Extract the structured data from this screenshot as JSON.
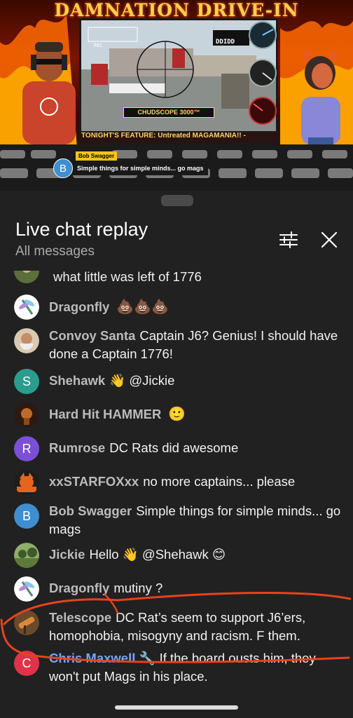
{
  "video": {
    "title": "DAMNATION DRIVE-IN",
    "scope_label": "CHUDSCOPE 3000™",
    "feature": "TONIGHT'S FEATURE: Untreated MAGAMANIA!! -",
    "osd_rec": "REC",
    "osd_cam": "DDIDD",
    "ticker": {
      "author": "Bob Swagger",
      "avatar_letter": "B",
      "text": "Simple things for simple minds... go mags"
    }
  },
  "chat": {
    "title": "Live chat replay",
    "subtitle": "All messages",
    "messages": [
      {
        "author": "",
        "text": "what little was left of 1776",
        "avatar_type": "image",
        "author_color": "default"
      },
      {
        "author": "Dragonfly",
        "text": "💩💩💩",
        "avatar_type": "image",
        "author_color": "default"
      },
      {
        "author": "Convoy Santa",
        "text": "Captain J6? Genius! I should have done a Captain 1776!",
        "avatar_type": "image",
        "author_color": "default"
      },
      {
        "author": "Shehawk",
        "text": "👋 @Jickie",
        "avatar_type": "letter",
        "avatar_letter": "S",
        "avatar_color": "#2a9d8f",
        "author_color": "default"
      },
      {
        "author": "Hard Hit HAMMER",
        "text": "🙂",
        "avatar_type": "image",
        "author_color": "default"
      },
      {
        "author": "Rumrose",
        "text": "DC Rats did awesome",
        "avatar_type": "letter",
        "avatar_letter": "R",
        "avatar_color": "#7b4fd6",
        "author_color": "default"
      },
      {
        "author": "xxSTARFOXxx",
        "text": "no more captains... please",
        "avatar_type": "image",
        "author_color": "default"
      },
      {
        "author": "Bob Swagger",
        "text": "Simple things for simple minds... go mags",
        "avatar_type": "letter",
        "avatar_letter": "B",
        "avatar_color": "#3e8ed0",
        "author_color": "default"
      },
      {
        "author": "Jickie",
        "text": "Hello 👋 @Shehawk 😊",
        "avatar_type": "image",
        "author_color": "default"
      },
      {
        "author": "Dragonfly",
        "text": "mutiny ?",
        "avatar_type": "image",
        "author_color": "default"
      },
      {
        "author": "Telescope",
        "text": "DC Rat’s seem to support J6’ers, homophobia, misogyny and racism. F them.",
        "avatar_type": "image",
        "author_color": "default"
      },
      {
        "author": "Chris Maxwell 🔧",
        "text": "If the board ousts him, they won't put Mags in his place.",
        "avatar_type": "letter",
        "avatar_letter": "C",
        "avatar_color": "#e0334a",
        "author_color": "blue"
      }
    ]
  },
  "colors": {
    "sheet_bg": "#212121",
    "accent_blue": "#6ea8fe",
    "annotation_red": "#e8421c"
  }
}
